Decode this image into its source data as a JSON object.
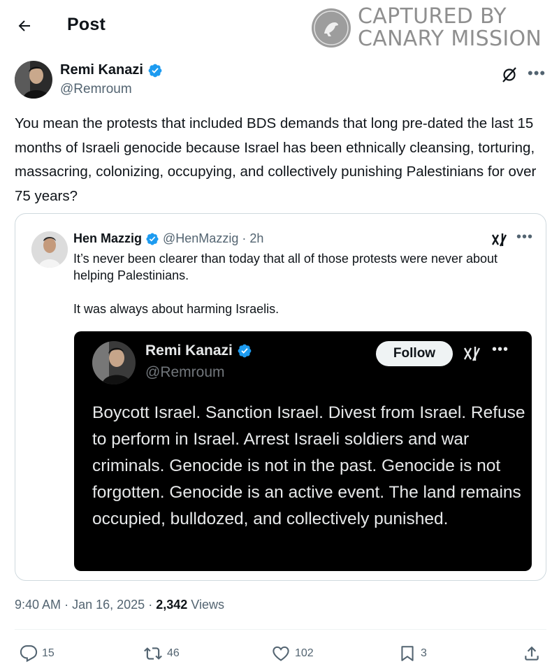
{
  "header": {
    "title": "Post",
    "back_icon": "arrow-left-icon"
  },
  "watermark": {
    "line1": "CAPTURED BY",
    "line2": "CANARY MISSION"
  },
  "post": {
    "author_name": "Remi Kanazi",
    "author_handle": "@Remroum",
    "text": "You mean the protests that included BDS demands that long pre-dated the last 15 months of Israeli genocide because Israel has been ethnically cleansing, torturing, massacring, colonizing, occupying, and collectively punishing Palestinians for over 75 years?",
    "time": "9:40 AM",
    "date": "Jan 16, 2025",
    "views_count": "2,342",
    "views_label": "Views",
    "separator": "·"
  },
  "quote": {
    "author_name": "Hen Mazzig",
    "author_handle": "@HenMazzig",
    "time": "2h",
    "separator": "·",
    "text": "It’s never been clearer than today that all of those protests were never about helping Palestinians.\n\nIt was always about harming Israelis."
  },
  "screenshot": {
    "author_name": "Remi Kanazi",
    "author_handle": "@Remroum",
    "follow_label": "Follow",
    "text": "Boycott Israel. Sanction Israel. Divest from Israel. Refuse to perform in Israel. Arrest Israeli soldiers and war criminals. Genocide is not in the past. Genocide is not forgotten. Genocide is an active event. The land remains occupied, bulldozed, and collectively punished."
  },
  "actions": {
    "replies": "15",
    "reposts": "46",
    "likes": "102",
    "bookmarks": "3"
  },
  "colors": {
    "verified": "#1d9bf0",
    "text_secondary": "#536471",
    "border": "#cfd9de"
  }
}
